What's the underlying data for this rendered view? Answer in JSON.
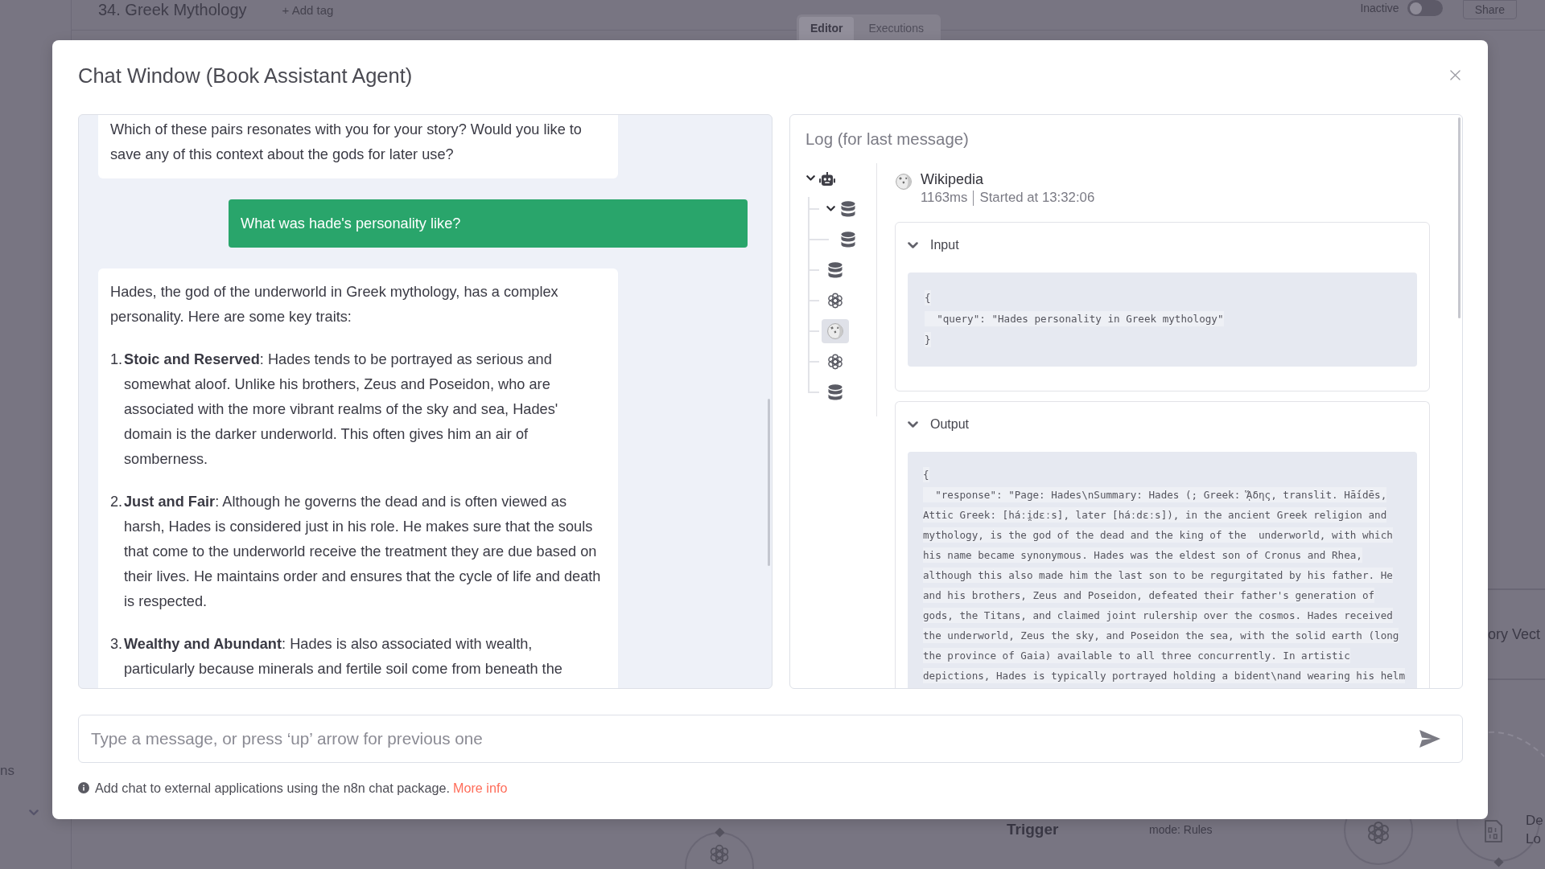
{
  "editor_backdrop": {
    "workflow_name": "34. Greek Mythology",
    "add_tag": "+ Add tag",
    "tabs": [
      {
        "label": "Editor",
        "selected": true
      },
      {
        "label": "Executions",
        "selected": false
      }
    ],
    "activation": {
      "label": "Inactive",
      "on": false
    },
    "share_button": "Share",
    "sidebar_label": "ns",
    "canvas": {
      "nodes": [
        {
          "kind": "box",
          "labels": [
            "ory Vect"
          ]
        },
        {
          "kind": "model"
        },
        {
          "kind": "model"
        },
        {
          "kind": "loader",
          "labels": [
            "De",
            "Lo"
          ]
        }
      ],
      "labels": [
        {
          "kind": "name",
          "text": "Trigger"
        },
        {
          "kind": "parameter",
          "text": "mode: Rules"
        }
      ]
    }
  },
  "chat_window": {
    "title": "Chat Window (Book Assistant Agent)",
    "messages": [
      {
        "kind": "bot",
        "paragraphs": [
          "Which of these pairs resonates with you for your story? Would you like to save any of this context about the gods for later use?"
        ]
      },
      {
        "kind": "user",
        "text": "What was hade's personality like?"
      },
      {
        "kind": "bot",
        "paragraphs": [
          "Hades, the god of the underworld in Greek mythology, has a complex personality. Here are some key traits:"
        ],
        "list": [
          {
            "number": "1.",
            "text": "**Stoic and Reserved**: Hades tends to be portrayed as serious and somewhat aloof. Unlike his brothers, Zeus and Poseidon, who are associated with the more vibrant realms of the sky and sea, Hades' domain is the darker underworld. This often gives him an air of somberness."
          },
          {
            "number": "2.",
            "text": "**Just and Fair**: Although he governs the dead and is often viewed as harsh, Hades is considered just in his role. He makes sure that the souls that come to the underworld receive the treatment they are due based on their lives. He maintains order and ensures that the cycle of life and death is respected."
          },
          {
            "number": "3.",
            "text": "**Wealthy and Abundant**: Hades is also associated with wealth, particularly because minerals and fertile soil come from beneath the"
          }
        ]
      }
    ],
    "log": {
      "title": "Log (for last message)",
      "tree": {
        "kind": "agent",
        "expanded": true,
        "selected": false,
        "children": [
          {
            "kind": "database",
            "expanded": true,
            "selected": false,
            "children": [
              {
                "kind": "database",
                "selected": false
              }
            ]
          },
          {
            "kind": "database",
            "selected": false
          },
          {
            "kind": "model",
            "selected": false
          },
          {
            "kind": "wikipedia",
            "selected": true
          },
          {
            "kind": "model",
            "selected": false
          },
          {
            "kind": "database",
            "selected": false
          }
        ]
      },
      "detail": {
        "kind": "wikipedia",
        "name": "Wikipedia",
        "duration": "1163ms",
        "started": "Started at 13:32:06",
        "sections": [
          {
            "title": "Input",
            "expanded": true,
            "lines": [
              "{",
              "  \"query\": \"Hades personality in Greek mythology\"",
              "}"
            ]
          },
          {
            "title": "Output",
            "expanded": true,
            "lines": [
              "{",
              "  \"response\": \"Page: Hades\\nSummary: Hades (; Greek: ᾍδης, translit. Hā́idēs,",
              "Attic Greek: [háːi̯dɛːs], later [háːdɛːs]), in the ancient Greek religion and",
              "mythology, is the god of the dead and the king of the  underworld, with which",
              "his name became synonymous. Hades was the eldest son of Cronus and Rhea,",
              "although this also made him the last son to be regurgitated by his father. He",
              "and his brothers, Zeus and Poseidon, defeated their father's generation of",
              "gods, the Titans, and claimed joint rulership over the cosmos. Hades received",
              "the underworld, Zeus the sky, and Poseidon the sea, with the solid earth (long",
              "the province of Gaia) available to all three concurrently. In artistic",
              "depictions, Hades is typically portrayed holding a bident\\nand wearing his helm"
            ]
          }
        ]
      }
    },
    "composer": {
      "placeholder": "Type a message, or press ‘up’ arrow for previous one"
    },
    "footer": {
      "text": "Add chat to external applications using the n8n chat package.",
      "link": "More info"
    }
  }
}
